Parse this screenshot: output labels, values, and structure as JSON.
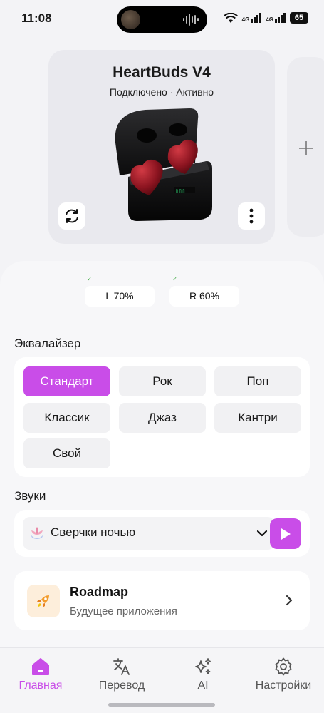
{
  "status_bar": {
    "time": "11:08",
    "network_1": "4G",
    "network_2": "4G",
    "battery": "65"
  },
  "device": {
    "name": "HeartBuds V4",
    "status": "Подключено · Активно",
    "battery_left": "L 70%",
    "battery_right": "R 60%"
  },
  "equalizer": {
    "title": "Эквалайзер",
    "presets": [
      {
        "label": "Стандарт",
        "active": true
      },
      {
        "label": "Рок"
      },
      {
        "label": "Поп"
      },
      {
        "label": "Классик"
      },
      {
        "label": "Джаз"
      },
      {
        "label": "Кантри"
      },
      {
        "label": "Свой"
      }
    ]
  },
  "sounds": {
    "title": "Звуки",
    "selected": "Сверчки ночью"
  },
  "roadmap": {
    "title": "Roadmap",
    "subtitle": "Будущее приложения"
  },
  "tabs": [
    {
      "label": "Главная",
      "icon": "home-icon",
      "active": true
    },
    {
      "label": "Перевод",
      "icon": "translate-icon"
    },
    {
      "label": "AI",
      "icon": "sparkles-icon"
    },
    {
      "label": "Настройки",
      "icon": "gear-icon"
    }
  ],
  "colors": {
    "accent": "#c94de8",
    "background": "#f3f3f6",
    "card": "#ffffff"
  }
}
